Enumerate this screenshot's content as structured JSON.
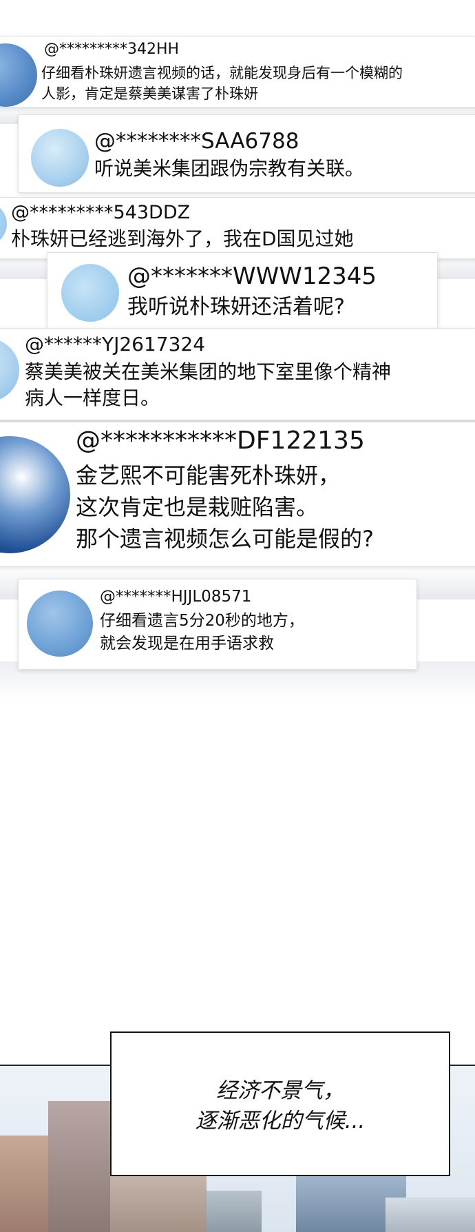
{
  "comments": [
    {
      "handle": "@*********342HH",
      "lines": [
        "仔细看朴珠妍遗言视频的话，就能发现身后有一个模糊的",
        "人影，肯定是蔡美美谋害了朴珠妍"
      ]
    },
    {
      "handle": "@********SAA6788",
      "lines": [
        "听说美米集团跟伪宗教有关联。"
      ]
    },
    {
      "handle": "@*********543DDZ",
      "lines": [
        "朴珠妍已经逃到海外了，我在D国见过她"
      ]
    },
    {
      "handle": "@*******WWW12345",
      "lines": [
        "我听说朴珠妍还活着呢?"
      ]
    },
    {
      "handle": "@******YJ2617324",
      "lines": [
        "蔡美美被关在美米集团的地下室里像个精神",
        "病人一样度日。"
      ]
    },
    {
      "handle": "@***********DF122135",
      "lines": [
        "金艺熙不可能害死朴珠妍，",
        "这次肯定也是栽赃陷害。",
        "那个遗言视频怎么可能是假的?"
      ]
    },
    {
      "handle": "@*******HJJL08571",
      "lines": [
        "仔细看遗言5分20秒的地方，",
        "就会发现是在用手语求救"
      ]
    }
  ],
  "caption": {
    "lines": [
      "经济不景气，",
      "逐渐恶化的气候..."
    ]
  },
  "colors": {
    "avatar_blue": "#5a8ecb",
    "avatar_light": "#a9d0ee",
    "avatar_navy": "#1f4f94"
  }
}
